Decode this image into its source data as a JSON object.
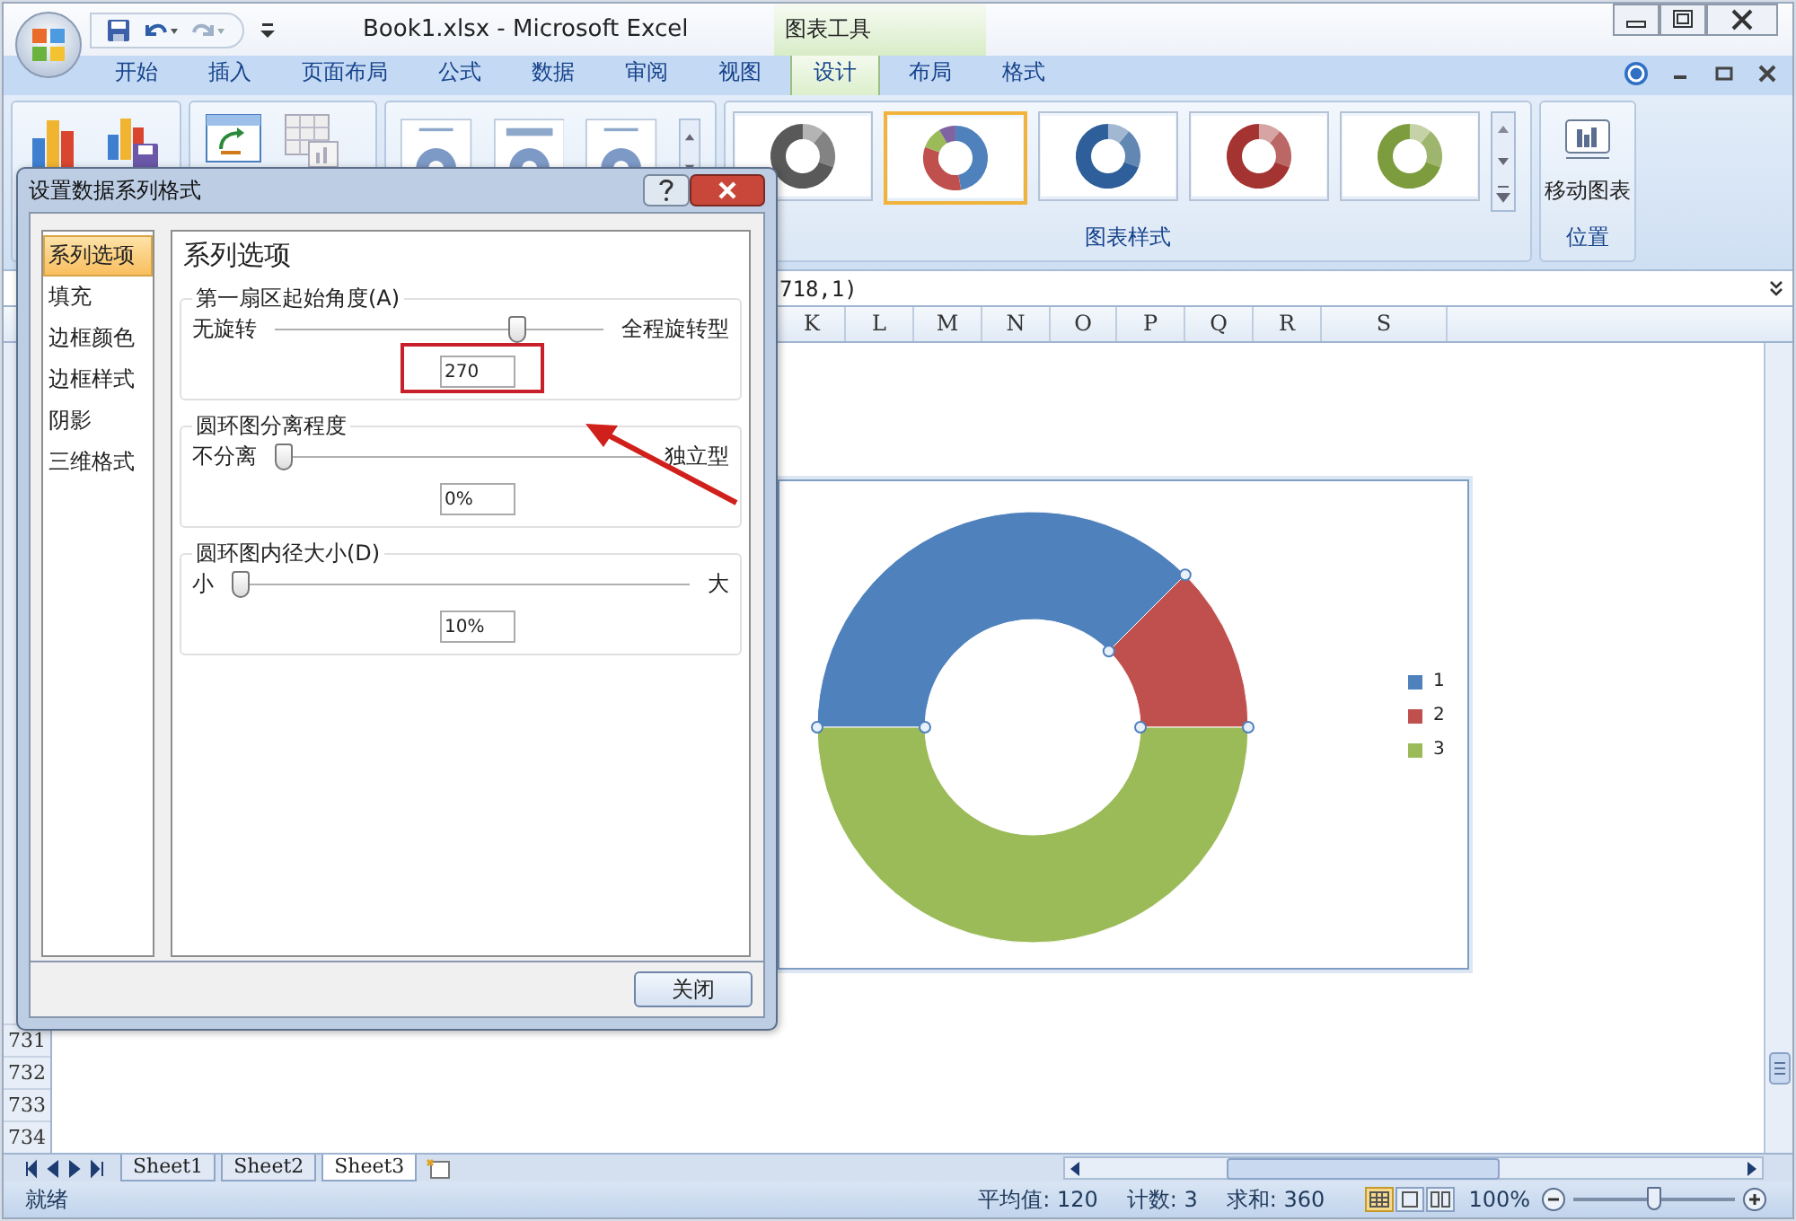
{
  "window": {
    "title": "Book1.xlsx - Microsoft Excel",
    "context_group": "图表工具"
  },
  "ribbon_tabs": [
    {
      "label": "开始",
      "selected": false
    },
    {
      "label": "插入",
      "selected": false
    },
    {
      "label": "页面布局",
      "selected": false
    },
    {
      "label": "公式",
      "selected": false
    },
    {
      "label": "数据",
      "selected": false
    },
    {
      "label": "审阅",
      "selected": false
    },
    {
      "label": "视图",
      "selected": false
    },
    {
      "label": "设计",
      "selected": true
    },
    {
      "label": "布局",
      "selected": false
    },
    {
      "label": "格式",
      "selected": false
    }
  ],
  "chart_styles": {
    "label": "图表样式",
    "styles": [
      {
        "kind": "mono",
        "color": "#595959",
        "selected": false
      },
      {
        "kind": "multi",
        "selected": true
      },
      {
        "kind": "mono",
        "color": "#2e5f9a",
        "selected": false
      },
      {
        "kind": "mono",
        "color": "#a33431",
        "selected": false
      },
      {
        "kind": "mono",
        "color": "#7d9c3e",
        "selected": false
      }
    ]
  },
  "location_group": {
    "label": "位置",
    "button": "移动图表"
  },
  "formula_bar": {
    "value": "718,1)"
  },
  "columns": [
    "K",
    "L",
    "M",
    "N",
    "O",
    "P",
    "Q",
    "R",
    "S"
  ],
  "row_numbers": [
    "731",
    "732",
    "733",
    "734"
  ],
  "chart": {
    "legend": [
      {
        "label": "1",
        "color": "#4f81bd"
      },
      {
        "label": "2",
        "color": "#c0504d"
      },
      {
        "label": "3",
        "color": "#9bbb59"
      }
    ]
  },
  "dialog": {
    "title": "设置数据系列格式",
    "nav": [
      {
        "label": "系列选项",
        "selected": true
      },
      {
        "label": "填充",
        "selected": false
      },
      {
        "label": "边框颜色",
        "selected": false
      },
      {
        "label": "边框样式",
        "selected": false
      },
      {
        "label": "阴影",
        "selected": false
      },
      {
        "label": "三维格式",
        "selected": false
      }
    ],
    "heading": "系列选项",
    "sections": [
      {
        "title": "第一扇区起始角度(A)",
        "min_label": "无旋转",
        "max_label": "全程旋转型",
        "level": 0.75,
        "value": "270",
        "highlighted": true
      },
      {
        "title": "圆环图分离程度",
        "min_label": "不分离",
        "max_label": "独立型",
        "level": 0,
        "value": "0%",
        "highlighted": false
      },
      {
        "title": "圆环图内径大小(D)",
        "min_label": "小",
        "max_label": "大",
        "level": 0,
        "value": "10%",
        "highlighted": false
      }
    ],
    "close_button": "关闭"
  },
  "sheet_tabs": [
    {
      "label": "Sheet1",
      "selected": false
    },
    {
      "label": "Sheet2",
      "selected": false
    },
    {
      "label": "Sheet3",
      "selected": true
    }
  ],
  "status_bar": {
    "mode": "就绪",
    "average": "平均值: 120",
    "count": "计数: 3",
    "sum": "求和: 360",
    "zoom": "100%",
    "zoom_slider": {
      "level": 0.5
    }
  }
}
